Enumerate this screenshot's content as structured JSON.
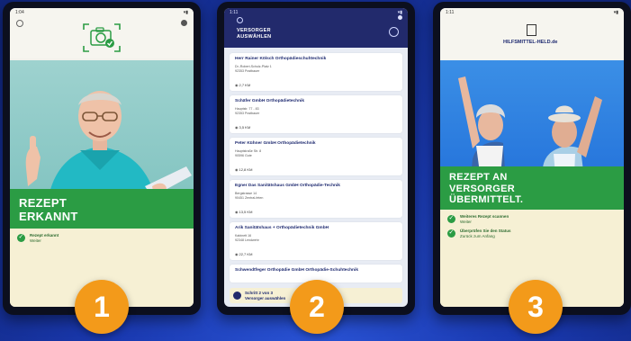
{
  "colors": {
    "background": "#1a39b0",
    "accent_green": "#2b9c44",
    "navy": "#222a6c",
    "badge_orange": "#f39a1a",
    "info_bg": "#f6f0d4"
  },
  "steps": [
    {
      "number": "1",
      "status_time": "1:04",
      "icons": [
        "gear-icon",
        "camera-check-icon",
        "menu-dot-icon"
      ],
      "card_title": [
        "REZEPT",
        "ERKANNT"
      ],
      "info": [
        "Rezept erkannt",
        "Weiter"
      ]
    },
    {
      "number": "2",
      "status_time": "1:11",
      "header_title": [
        "VERSORGER",
        "AUSWÄHLEN"
      ],
      "providers": [
        {
          "name": "Herr Rainer Kölsch Orthopädieschuhtechnik",
          "address": "Dr.-Robert-Schulz-Platz 1\n92353 Postbauer",
          "distance": "2,7 KM"
        },
        {
          "name": "Schäfer GmbH Orthopädietechnik",
          "address": "Hauptstr. 77 - 83\n92353 Postbauer",
          "distance": "3,5 KM"
        },
        {
          "name": "Peter Kühner GmbH Orthopädietechnik",
          "address": "Hauptstraße Str. 8\n90596 Gute",
          "distance": "12,8 KM"
        },
        {
          "name": "Egner Das Sanitätshaus GmbH Orthopädie-Technik",
          "address": "Bergstrasse 14\n90451 Zentral-feten",
          "distance": "13,5 KM"
        },
        {
          "name": "Arik Sanitätshaus + Orthopädietechnik GmbH",
          "address": "Kabinett 16\n92348 Lendwehr",
          "distance": "22,7 KM"
        },
        {
          "name": "Schwendtfeger Orthopädie GmbH Orthopädie-Schuhtechnik",
          "address": "",
          "distance": ""
        }
      ],
      "bottom": [
        "Schritt 2 von 3",
        "Versorger auswählen"
      ]
    },
    {
      "number": "3",
      "status_time": "1:11",
      "logo_text": "HILFSMITTEL-HELD.de",
      "card_title": [
        "REZEPT AN",
        "VERSORGER",
        "ÜBERMITTELT."
      ],
      "info": [
        "Weiteres Rezept scannen",
        "Weiter",
        "Überprüfen Sie den Status",
        "Zurück zum Anfang"
      ]
    }
  ]
}
